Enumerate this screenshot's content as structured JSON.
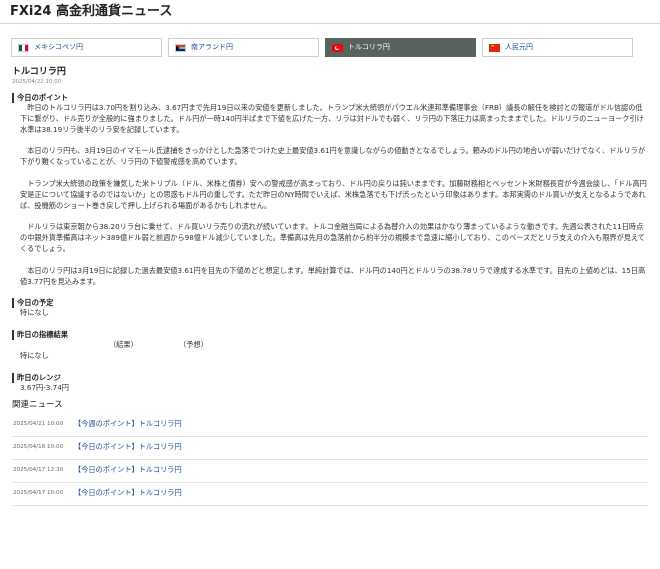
{
  "header": {
    "title": "FXi24 高金利通貨ニュース"
  },
  "tabs": [
    {
      "label": "メキシコペソ円",
      "flag": "mexico-flag-icon"
    },
    {
      "label": "南アランド円",
      "flag": "south-africa-flag-icon"
    },
    {
      "label": "トルコリラ円",
      "flag": "turkey-flag-icon"
    },
    {
      "label": "人民元円",
      "flag": "china-flag-icon"
    }
  ],
  "article": {
    "title": "トルコリラ円",
    "date": "2025/04/22 10:00",
    "point_heading": "今日のポイント",
    "paragraphs": [
      "昨日のトルコリラ円は3.70円を割り込み、3.67円まで先月19日以来の安値を更新しました。トランプ米大統領がパウエル米連邦準備理事会（FRB）議長の解任を検討との報道がドル信認の低下に繋がり、ドル売りが全般的に強まりました。ドル円が一時140円半ばまで下値を広げた一方、リラは対ドルでも弱く、リラ円の下落圧力は高まったままでした。ドルリラのニューヨーク引け水準は38.19リラ後半のリラ安を記録しています。",
      "本日のリラ円も、3月19日のイマモール氏逮捕をきっかけとした急落でつけた史上最安値3.61円を意識しながらの値動きとなるでしょう。頼みのドル円の地合いが弱いだけでなく、ドルリラが下がり難くなっていることが、リラ円の下値警戒感を高めています。",
      "トランプ米大統領の政策を嫌気した米トリプル（ドル、米株と債券）安への警戒感が高まっており、ドル円の戻りは鈍いままです。加藤財務相とベッセント米財務長官が今週会談し、「ドル高円安是正について協議するのではないか」との思惑もドル円の重しです。ただ昨日のNY時間でいえば、米株急落でも下げ渋ったという印象はあります。本邦実需のドル買いが支えとなるようであれば、投機筋のショート巻き戻しで押し上げられる場面があるかもしれません。",
      "ドルリラは東京朝から38.20リラ台に乗せて、ドル買いリラ売りの流れが続いています。トルコ金融当局による為替介入の効果はかなり薄まっているような動きです。先週公表された11日時点の中銀外貨準備高はネット389億ドル弱と前週から98億ドル減少していました。準備高は先月の急落前から約半分の規模まで急速に縮小しており、このペースだとリラ支えの介入も限界が見えてくるでしょう。",
      "本日のリラ円は3月19日に記録した過去最安値3.61円を目先の下値めどと想定します。単純計算では、ドル円の140円とドルリラの38.78リラで達成する水準です。目先の上値めどは、15日高値3.77円を見込みます。"
    ]
  },
  "today_schedule": {
    "heading": "今日の予定",
    "value": "特になし"
  },
  "yesterday_results": {
    "heading": "昨日の指標結果",
    "col_actual": "（結果）",
    "col_forecast": "（予想）",
    "value": "特になし"
  },
  "yesterday_range": {
    "heading": "昨日のレンジ",
    "value": "3.67円-3.74円"
  },
  "related": {
    "title": "関連ニュース",
    "items": [
      {
        "date": "2025/04/21 10:00",
        "link": "【今週のポイント】トルコリラ円"
      },
      {
        "date": "2025/04/18 10:00",
        "link": "【今日のポイント】トルコリラ円"
      },
      {
        "date": "2025/04/17 12:30",
        "link": "【今日のポイント】トルコリラ円"
      },
      {
        "date": "2025/04/17 10:00",
        "link": "【今日のポイント】トルコリラ円"
      }
    ]
  }
}
